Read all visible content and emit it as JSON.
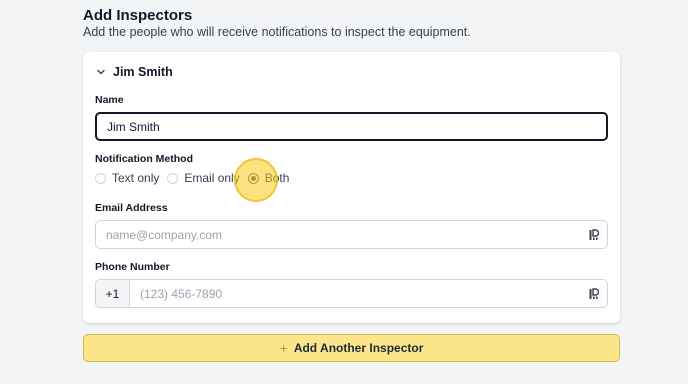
{
  "section": {
    "title": "Add Inspectors",
    "description": "Add the people who will receive notifications to inspect the equipment."
  },
  "inspector": {
    "header": "Jim Smith",
    "name_label": "Name",
    "name_value": "Jim Smith",
    "method_label": "Notification Method",
    "methods": [
      {
        "label": "Text only",
        "checked": false
      },
      {
        "label": "Email only",
        "checked": false
      },
      {
        "label": "Both",
        "checked": true
      }
    ],
    "email_label": "Email Address",
    "email_placeholder": "name@company.com",
    "email_value": "",
    "phone_label": "Phone Number",
    "phone_prefix": "+1",
    "phone_placeholder": "(123) 456-7890",
    "phone_value": ""
  },
  "actions": {
    "add_plus": "+",
    "add_label": "Add Another Inspector"
  },
  "colors": {
    "accent_button_bg": "#fde68a",
    "highlight": "#facc15",
    "focused_border": "#111827"
  }
}
